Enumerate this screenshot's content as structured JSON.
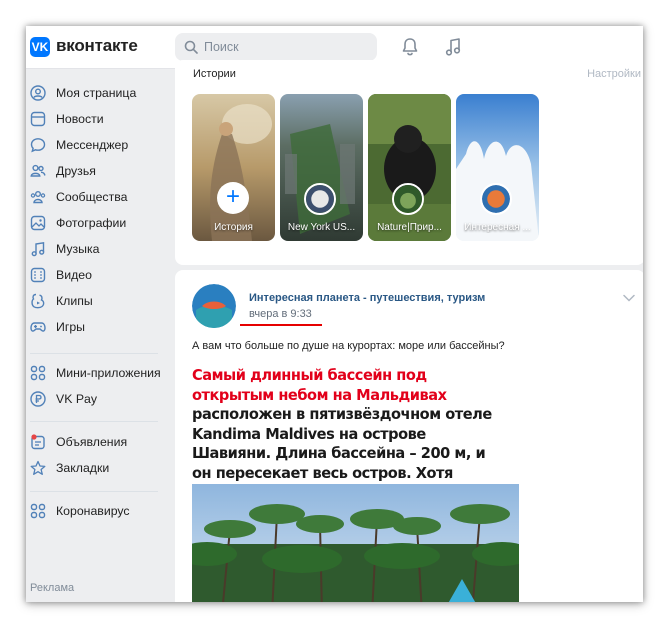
{
  "header": {
    "logo_mark": "VK",
    "logo_text": "вконтакте",
    "search_placeholder": "Поиск",
    "icons": [
      "search-icon",
      "bell-icon",
      "music-note-icon"
    ]
  },
  "sidebar": {
    "items": [
      {
        "label": "Моя страница",
        "icon": "user-circle-icon"
      },
      {
        "label": "Новости",
        "icon": "news-icon"
      },
      {
        "label": "Мессенджер",
        "icon": "chat-bubble-icon"
      },
      {
        "label": "Друзья",
        "icon": "friends-icon"
      },
      {
        "label": "Сообщества",
        "icon": "communities-icon"
      },
      {
        "label": "Фотографии",
        "icon": "photo-icon"
      },
      {
        "label": "Музыка",
        "icon": "music-icon"
      },
      {
        "label": "Видео",
        "icon": "video-icon"
      },
      {
        "label": "Клипы",
        "icon": "clips-icon"
      },
      {
        "label": "Игры",
        "icon": "gamepad-icon"
      }
    ],
    "group2": [
      {
        "label": "Мини-приложения",
        "icon": "apps-icon"
      },
      {
        "label": "VK Pay",
        "icon": "vkpay-icon"
      }
    ],
    "group3": [
      {
        "label": "Объявления",
        "icon": "classifieds-icon"
      },
      {
        "label": "Закладки",
        "icon": "star-icon"
      }
    ],
    "group4": [
      {
        "label": "Коронавирус",
        "icon": "apps-icon"
      }
    ],
    "ads_label": "Реклама"
  },
  "stories": {
    "title": "Истории",
    "settings": "Настройки",
    "items": [
      {
        "caption": "История"
      },
      {
        "caption": "New York US..."
      },
      {
        "caption": "Nature|Прир..."
      },
      {
        "caption": "Интересная ..."
      }
    ]
  },
  "post": {
    "author": "Интересная планета - путешествия, туризм",
    "time": "вчера в 9:33",
    "text": "А вам что больше по душе на курортах: море или бассейны?",
    "poster_red": "Самый длинный бассейн под открытым небом на Мальдивах",
    "poster_dark": " расположен в пятизвёздочном отеле Kandima Maldives на острове Шавияни. Длина бассейна – 200 м, и он пересекает весь остров. Хотя какой бассейн, если рядом океан?"
  },
  "colors": {
    "brand": "#0077ff",
    "link": "#2a5885",
    "background": "#edeef0",
    "highlight": "#e60000"
  }
}
